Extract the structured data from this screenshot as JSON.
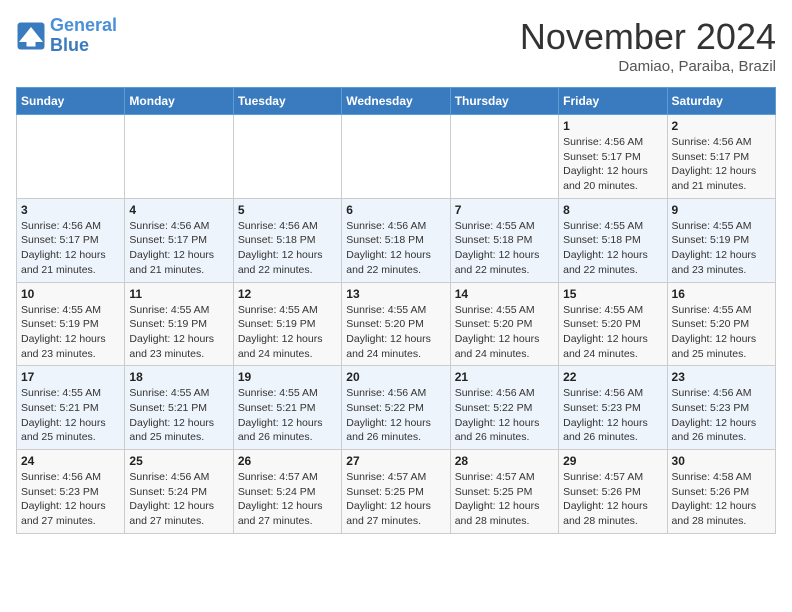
{
  "header": {
    "logo_line1": "General",
    "logo_line2": "Blue",
    "month": "November 2024",
    "location": "Damiao, Paraiba, Brazil"
  },
  "weekdays": [
    "Sunday",
    "Monday",
    "Tuesday",
    "Wednesday",
    "Thursday",
    "Friday",
    "Saturday"
  ],
  "weeks": [
    [
      {
        "day": "",
        "sunrise": "",
        "sunset": "",
        "daylight": ""
      },
      {
        "day": "",
        "sunrise": "",
        "sunset": "",
        "daylight": ""
      },
      {
        "day": "",
        "sunrise": "",
        "sunset": "",
        "daylight": ""
      },
      {
        "day": "",
        "sunrise": "",
        "sunset": "",
        "daylight": ""
      },
      {
        "day": "",
        "sunrise": "",
        "sunset": "",
        "daylight": ""
      },
      {
        "day": "1",
        "sunrise": "Sunrise: 4:56 AM",
        "sunset": "Sunset: 5:17 PM",
        "daylight": "Daylight: 12 hours and 20 minutes."
      },
      {
        "day": "2",
        "sunrise": "Sunrise: 4:56 AM",
        "sunset": "Sunset: 5:17 PM",
        "daylight": "Daylight: 12 hours and 21 minutes."
      }
    ],
    [
      {
        "day": "3",
        "sunrise": "Sunrise: 4:56 AM",
        "sunset": "Sunset: 5:17 PM",
        "daylight": "Daylight: 12 hours and 21 minutes."
      },
      {
        "day": "4",
        "sunrise": "Sunrise: 4:56 AM",
        "sunset": "Sunset: 5:17 PM",
        "daylight": "Daylight: 12 hours and 21 minutes."
      },
      {
        "day": "5",
        "sunrise": "Sunrise: 4:56 AM",
        "sunset": "Sunset: 5:18 PM",
        "daylight": "Daylight: 12 hours and 22 minutes."
      },
      {
        "day": "6",
        "sunrise": "Sunrise: 4:56 AM",
        "sunset": "Sunset: 5:18 PM",
        "daylight": "Daylight: 12 hours and 22 minutes."
      },
      {
        "day": "7",
        "sunrise": "Sunrise: 4:55 AM",
        "sunset": "Sunset: 5:18 PM",
        "daylight": "Daylight: 12 hours and 22 minutes."
      },
      {
        "day": "8",
        "sunrise": "Sunrise: 4:55 AM",
        "sunset": "Sunset: 5:18 PM",
        "daylight": "Daylight: 12 hours and 22 minutes."
      },
      {
        "day": "9",
        "sunrise": "Sunrise: 4:55 AM",
        "sunset": "Sunset: 5:19 PM",
        "daylight": "Daylight: 12 hours and 23 minutes."
      }
    ],
    [
      {
        "day": "10",
        "sunrise": "Sunrise: 4:55 AM",
        "sunset": "Sunset: 5:19 PM",
        "daylight": "Daylight: 12 hours and 23 minutes."
      },
      {
        "day": "11",
        "sunrise": "Sunrise: 4:55 AM",
        "sunset": "Sunset: 5:19 PM",
        "daylight": "Daylight: 12 hours and 23 minutes."
      },
      {
        "day": "12",
        "sunrise": "Sunrise: 4:55 AM",
        "sunset": "Sunset: 5:19 PM",
        "daylight": "Daylight: 12 hours and 24 minutes."
      },
      {
        "day": "13",
        "sunrise": "Sunrise: 4:55 AM",
        "sunset": "Sunset: 5:20 PM",
        "daylight": "Daylight: 12 hours and 24 minutes."
      },
      {
        "day": "14",
        "sunrise": "Sunrise: 4:55 AM",
        "sunset": "Sunset: 5:20 PM",
        "daylight": "Daylight: 12 hours and 24 minutes."
      },
      {
        "day": "15",
        "sunrise": "Sunrise: 4:55 AM",
        "sunset": "Sunset: 5:20 PM",
        "daylight": "Daylight: 12 hours and 24 minutes."
      },
      {
        "day": "16",
        "sunrise": "Sunrise: 4:55 AM",
        "sunset": "Sunset: 5:20 PM",
        "daylight": "Daylight: 12 hours and 25 minutes."
      }
    ],
    [
      {
        "day": "17",
        "sunrise": "Sunrise: 4:55 AM",
        "sunset": "Sunset: 5:21 PM",
        "daylight": "Daylight: 12 hours and 25 minutes."
      },
      {
        "day": "18",
        "sunrise": "Sunrise: 4:55 AM",
        "sunset": "Sunset: 5:21 PM",
        "daylight": "Daylight: 12 hours and 25 minutes."
      },
      {
        "day": "19",
        "sunrise": "Sunrise: 4:55 AM",
        "sunset": "Sunset: 5:21 PM",
        "daylight": "Daylight: 12 hours and 26 minutes."
      },
      {
        "day": "20",
        "sunrise": "Sunrise: 4:56 AM",
        "sunset": "Sunset: 5:22 PM",
        "daylight": "Daylight: 12 hours and 26 minutes."
      },
      {
        "day": "21",
        "sunrise": "Sunrise: 4:56 AM",
        "sunset": "Sunset: 5:22 PM",
        "daylight": "Daylight: 12 hours and 26 minutes."
      },
      {
        "day": "22",
        "sunrise": "Sunrise: 4:56 AM",
        "sunset": "Sunset: 5:23 PM",
        "daylight": "Daylight: 12 hours and 26 minutes."
      },
      {
        "day": "23",
        "sunrise": "Sunrise: 4:56 AM",
        "sunset": "Sunset: 5:23 PM",
        "daylight": "Daylight: 12 hours and 26 minutes."
      }
    ],
    [
      {
        "day": "24",
        "sunrise": "Sunrise: 4:56 AM",
        "sunset": "Sunset: 5:23 PM",
        "daylight": "Daylight: 12 hours and 27 minutes."
      },
      {
        "day": "25",
        "sunrise": "Sunrise: 4:56 AM",
        "sunset": "Sunset: 5:24 PM",
        "daylight": "Daylight: 12 hours and 27 minutes."
      },
      {
        "day": "26",
        "sunrise": "Sunrise: 4:57 AM",
        "sunset": "Sunset: 5:24 PM",
        "daylight": "Daylight: 12 hours and 27 minutes."
      },
      {
        "day": "27",
        "sunrise": "Sunrise: 4:57 AM",
        "sunset": "Sunset: 5:25 PM",
        "daylight": "Daylight: 12 hours and 27 minutes."
      },
      {
        "day": "28",
        "sunrise": "Sunrise: 4:57 AM",
        "sunset": "Sunset: 5:25 PM",
        "daylight": "Daylight: 12 hours and 28 minutes."
      },
      {
        "day": "29",
        "sunrise": "Sunrise: 4:57 AM",
        "sunset": "Sunset: 5:26 PM",
        "daylight": "Daylight: 12 hours and 28 minutes."
      },
      {
        "day": "30",
        "sunrise": "Sunrise: 4:58 AM",
        "sunset": "Sunset: 5:26 PM",
        "daylight": "Daylight: 12 hours and 28 minutes."
      }
    ]
  ]
}
